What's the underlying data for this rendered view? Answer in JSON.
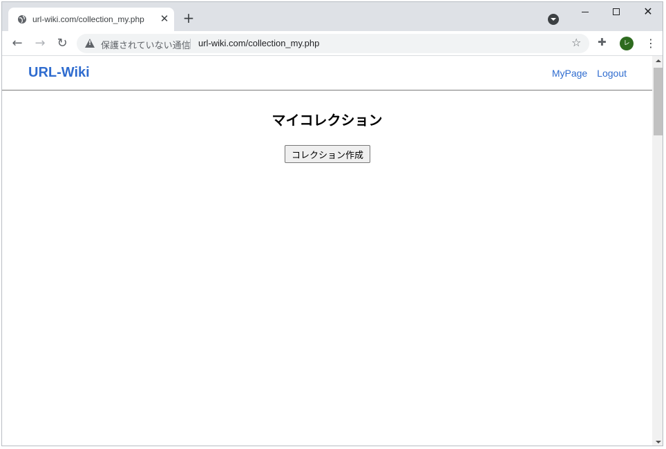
{
  "browser": {
    "tab_title": "url-wiki.com/collection_my.php",
    "security_label": "保護されていない通信",
    "url": "url-wiki.com/collection_my.php",
    "avatar_initial": "レ"
  },
  "site": {
    "brand": "URL-Wiki",
    "nav": {
      "mypage": "MyPage",
      "logout": "Logout"
    }
  },
  "main": {
    "title": "マイコレクション",
    "create_button_label": "コレクション作成"
  },
  "colors": {
    "link": "#2f6ccf",
    "tabstrip": "#dee1e6",
    "avatar": "#2e6b1f"
  }
}
